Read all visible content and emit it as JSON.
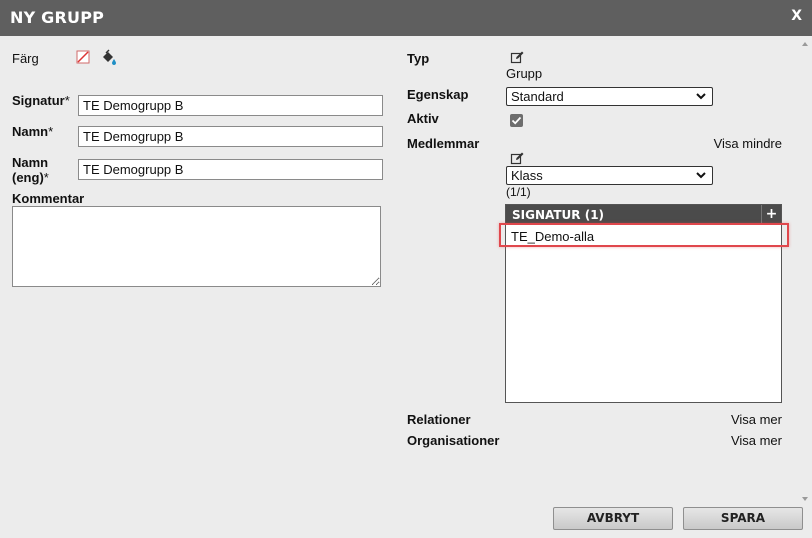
{
  "dialog": {
    "title": "NY GRUPP",
    "close_label": "X"
  },
  "left": {
    "color_label": "Färg",
    "signatur_label": "Signatur",
    "signatur_value": "TE Demogrupp B",
    "namn_label": "Namn",
    "namn_value": "TE Demogrupp B",
    "namn_eng_label_line1": "Namn",
    "namn_eng_label_line2": "(eng)",
    "namn_eng_value": "TE Demogrupp B",
    "required_mark": "*",
    "kommentar_label": "Kommentar",
    "kommentar_value": ""
  },
  "right": {
    "typ_label": "Typ",
    "typ_value": "Grupp",
    "egenskap_label": "Egenskap",
    "egenskap_value": "Standard",
    "aktiv_label": "Aktiv",
    "aktiv_checked": true,
    "medlemmar_label": "Medlemmar",
    "visa_mindre": "Visa mindre",
    "klass_value": "Klass",
    "count": "(1/1)",
    "list_header": "SIGNATUR (1)",
    "add_label": "+",
    "members": [
      "TE_Demo-alla"
    ],
    "relationer_label": "Relationer",
    "relationer_link": "Visa mer",
    "organisationer_label": "Organisationer",
    "organisationer_link": "Visa mer"
  },
  "buttons": {
    "cancel": "AVBRYT",
    "save": "SPARA"
  },
  "colors": {
    "titlebar": "#5f5f5f",
    "highlight": "#e0474c",
    "list_header": "#4b4b4b"
  },
  "icons": [
    "no-color-icon",
    "paint-bucket-icon",
    "edit-icon",
    "chevron-down-icon",
    "checkmark-icon"
  ]
}
